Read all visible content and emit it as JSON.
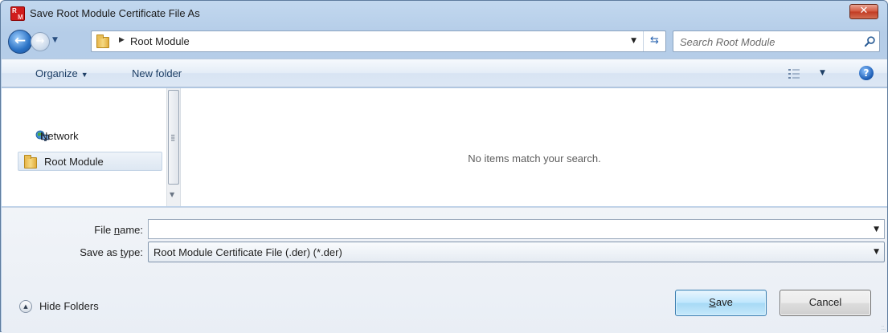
{
  "window": {
    "title": "Save Root Module Certificate File As",
    "app_icon_text_top": "R",
    "app_icon_text_bottom": "M",
    "close_glyph": "✕"
  },
  "address_bar": {
    "back_glyph": "←",
    "forward_glyph": "→",
    "dropdown_glyph": "▼",
    "crumb_separator": "▶",
    "current_folder": "Root Module",
    "address_dropdown_glyph": "▼",
    "refresh_glyph": "⇆",
    "search_placeholder": "Search Root Module",
    "search_value": ""
  },
  "toolbar": {
    "organize_label": "Organize",
    "organize_caret": "▼",
    "new_folder_label": "New folder",
    "view_caret": "▼",
    "help_glyph": "?"
  },
  "navigation_pane": {
    "items": [
      {
        "label": "Network",
        "icon": "network-icon",
        "selected": false
      },
      {
        "label": "Root Module",
        "icon": "folder-icon",
        "selected": true
      }
    ],
    "scroll_down_glyph": "▼"
  },
  "file_list": {
    "empty_message": "No items match your search."
  },
  "form": {
    "file_name_label_pre": "File ",
    "file_name_label_accel": "n",
    "file_name_label_post": "ame:",
    "file_name_value": "",
    "combo_arrow": "▼",
    "save_type_label_pre": "Save as ",
    "save_type_label_accel": "t",
    "save_type_label_post": "ype:",
    "save_type_value": "Root Module Certificate File (.der) (*.der)",
    "hide_folders_label": "Hide Folders",
    "hide_folders_glyph": "▲",
    "save_accel": "S",
    "save_rest": "ave",
    "cancel_label": "Cancel"
  },
  "colors": {
    "title_bar": "#c2d8ef",
    "close_button": "#c13a22",
    "selected_item": "#dde7f2",
    "save_button": "#bee6fd"
  }
}
